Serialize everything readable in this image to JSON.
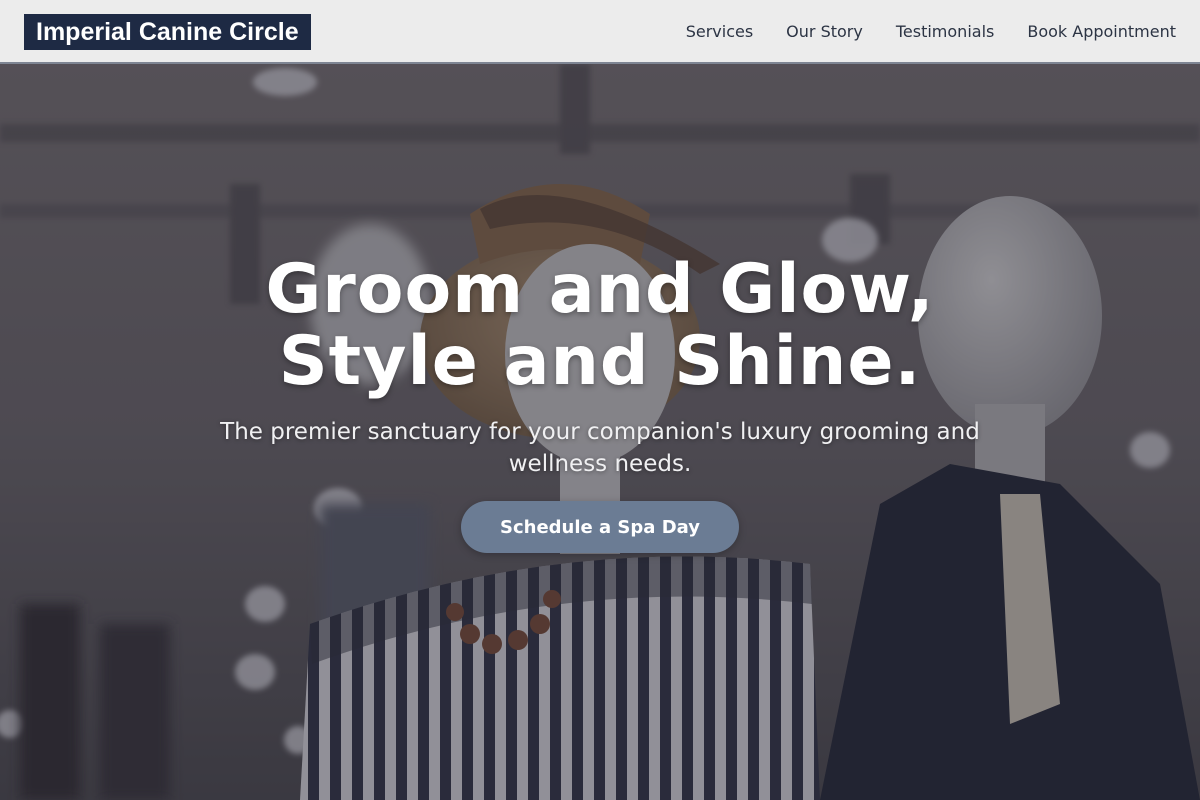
{
  "header": {
    "brand": "Imperial Canine Circle",
    "nav": [
      {
        "label": "Services"
      },
      {
        "label": "Our Story"
      },
      {
        "label": "Testimonials"
      },
      {
        "label": "Book Appointment"
      }
    ]
  },
  "hero": {
    "headline_line1": "Groom and Glow,",
    "headline_line2": "Style and Shine.",
    "subheadline": "The premier sanctuary for your companion's luxury grooming and wellness needs.",
    "cta_label": "Schedule a Spa Day",
    "background_image": "mannequins-in-clothing-store-photo"
  },
  "colors": {
    "header_bg": "#ececec",
    "brand_bg": "#1e2a44",
    "cta_bg": "#6b7c94",
    "nav_text": "#2c3444"
  }
}
